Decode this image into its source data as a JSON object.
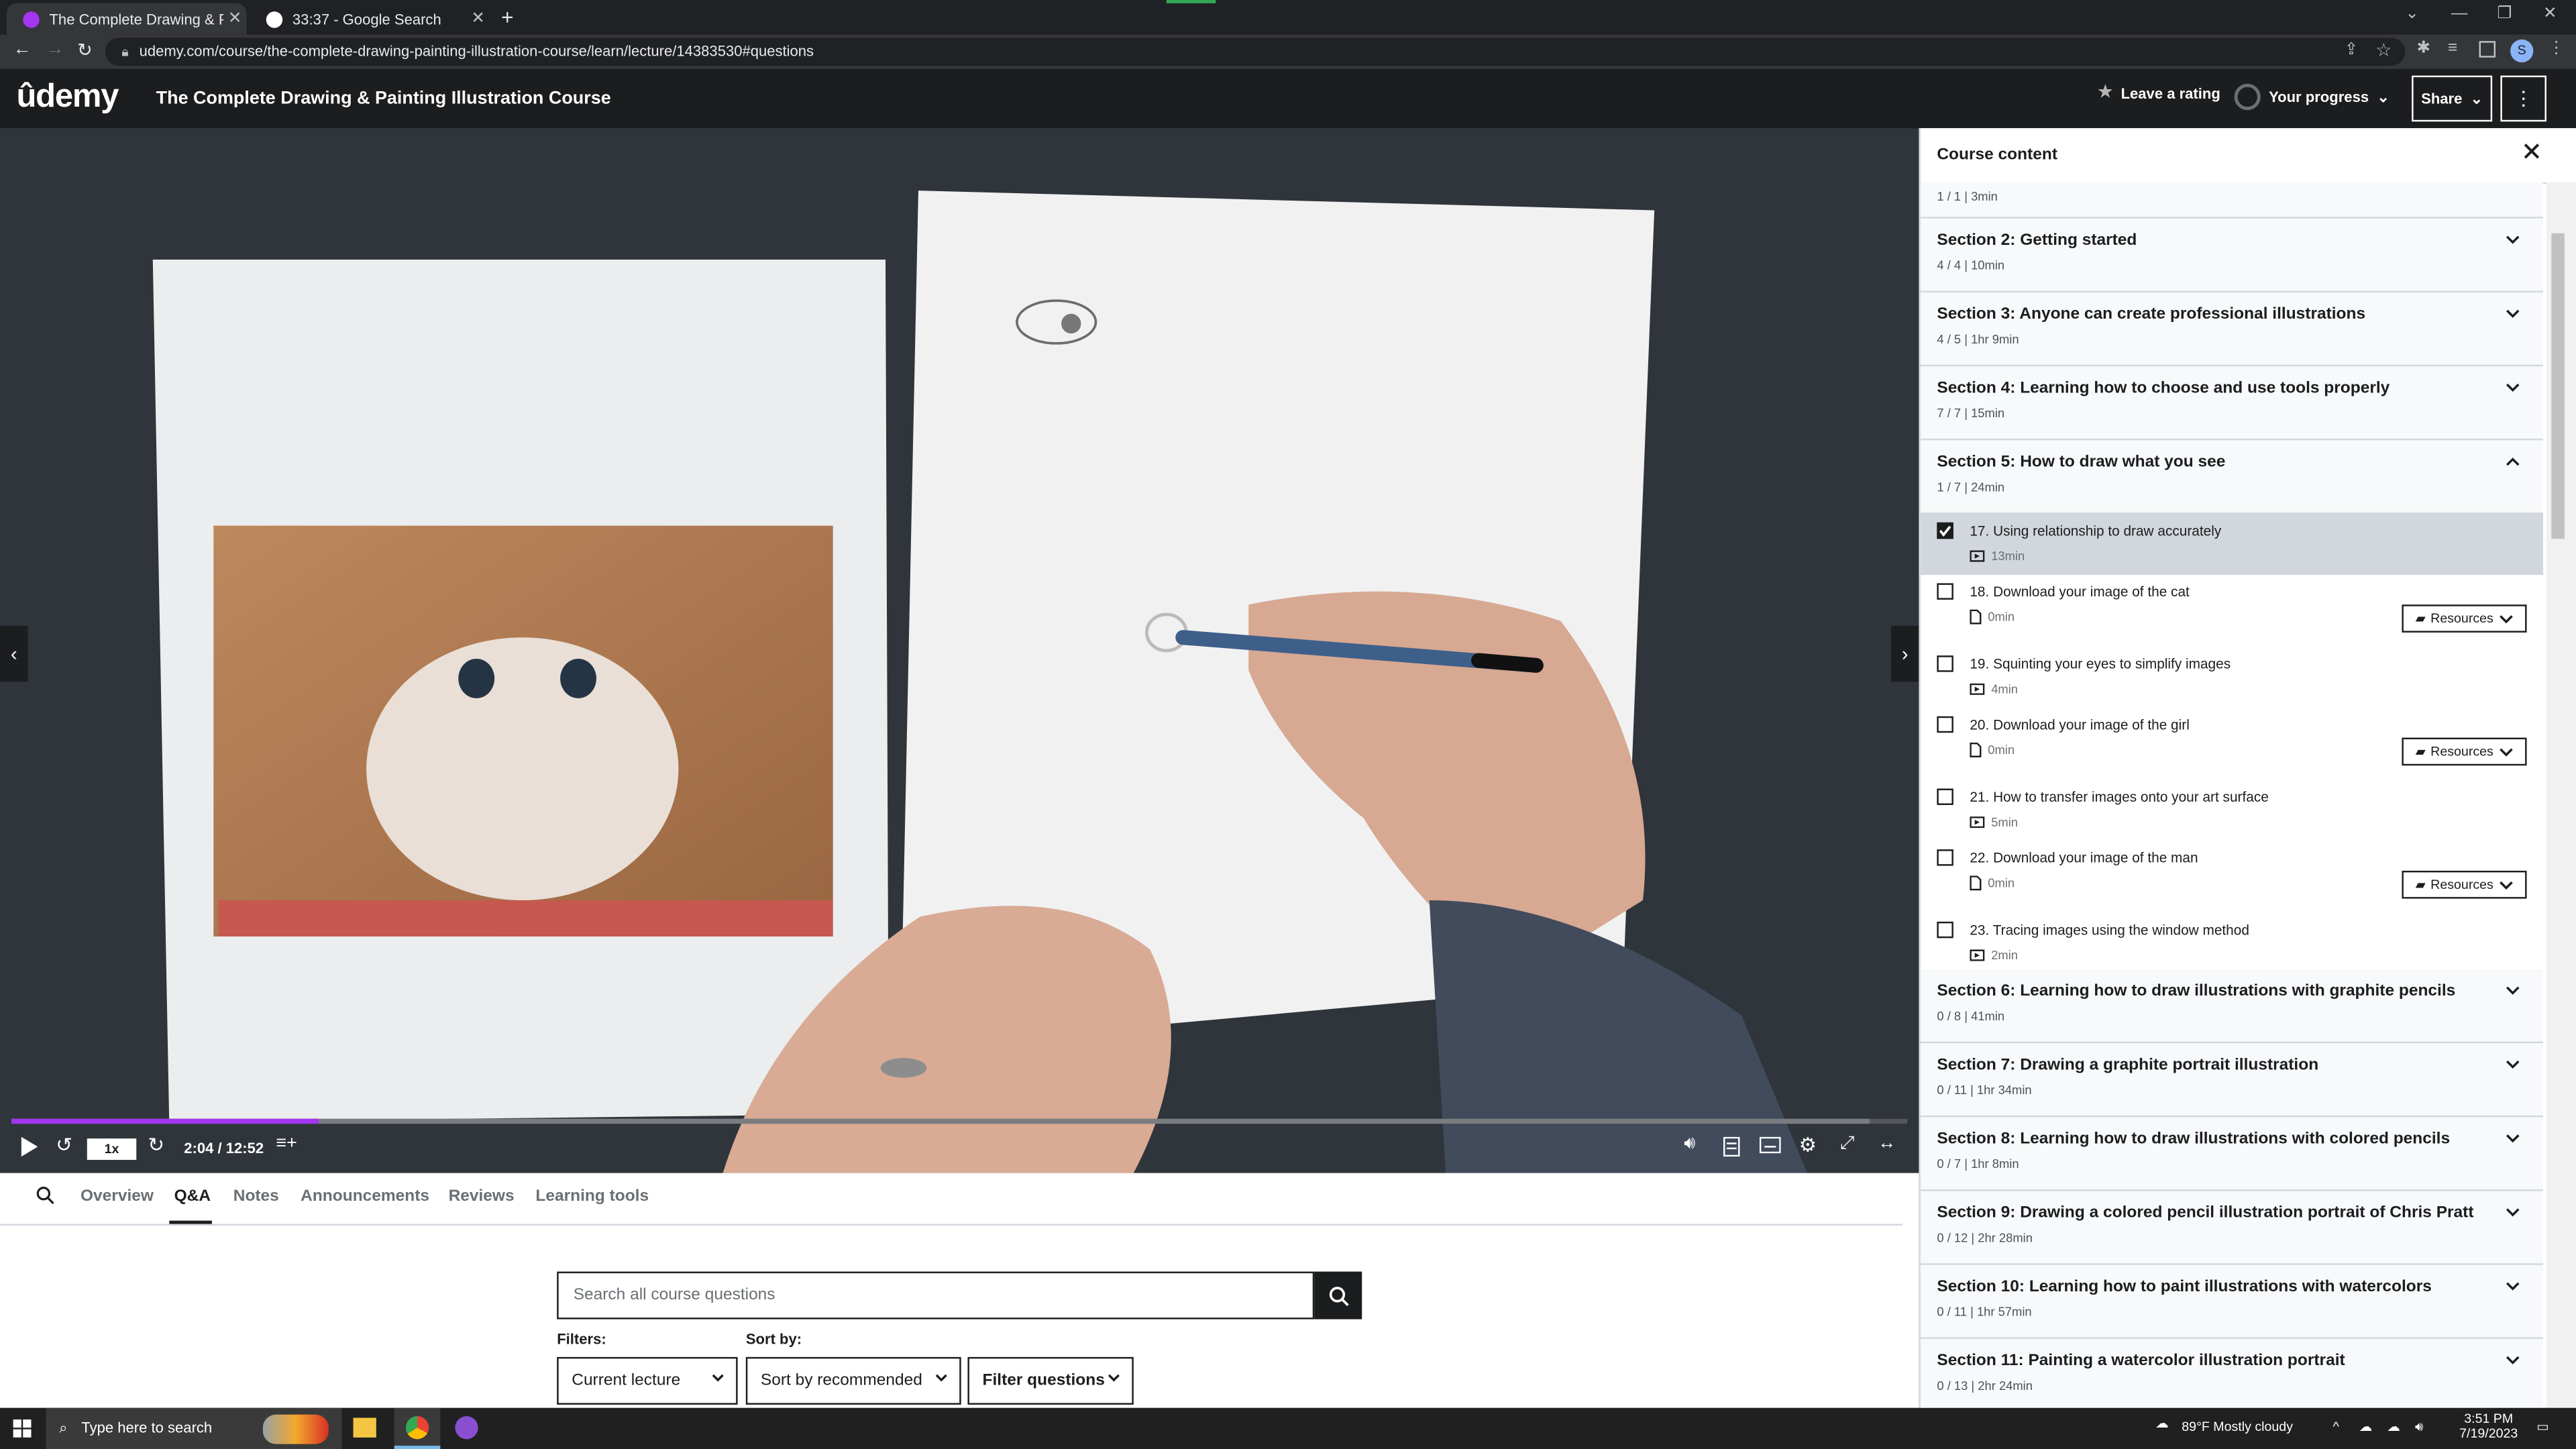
{
  "browser": {
    "tabs": [
      {
        "title": "The Complete Drawing & Paintin",
        "active": true
      },
      {
        "title": "33:37 - Google Search",
        "active": false
      }
    ],
    "url": "udemy.com/course/the-complete-drawing-painting-illustration-course/learn/lecture/14383530#questions"
  },
  "header": {
    "logo": "ûdemy",
    "course_title": "The Complete Drawing & Painting Illustration Course",
    "leave_rating": "Leave a rating",
    "your_progress": "Your progress",
    "share": "Share"
  },
  "player": {
    "speed": "1x",
    "time": "2:04 / 12:52",
    "progress_fraction": 0.162,
    "buffered_fraction": 0.98
  },
  "content_tabs": [
    "Overview",
    "Q&A",
    "Notes",
    "Announcements",
    "Reviews",
    "Learning tools"
  ],
  "active_tab": "Q&A",
  "qa": {
    "search_placeholder": "Search all course questions",
    "filters_label": "Filters:",
    "sort_label": "Sort by:",
    "filter_value": "Current lecture",
    "sort_value": "Sort by recommended",
    "filter_questions": "Filter questions"
  },
  "sidebar": {
    "title": "Course content",
    "top_meta": "1 / 1 | 3min",
    "sections_before": [
      {
        "title": "Section 2: Getting started",
        "meta": "4 / 4 | 10min"
      },
      {
        "title": "Section 3: Anyone can create professional illustrations",
        "meta": "4 / 5 | 1hr 9min"
      },
      {
        "title": "Section 4: Learning how to choose and use tools properly",
        "meta": "7 / 7 | 15min"
      }
    ],
    "open_section": {
      "title": "Section 5: How to draw what you see",
      "meta": "1 / 7 | 24min"
    },
    "lectures": [
      {
        "title": "17. Using relationship to draw accurately",
        "meta": "13min",
        "type": "video",
        "checked": true,
        "current": true,
        "resources": ""
      },
      {
        "title": "18. Download your image of the cat",
        "meta": "0min",
        "type": "file",
        "checked": false,
        "current": false,
        "resources": "Resources"
      },
      {
        "title": "19. Squinting your eyes to simplify images",
        "meta": "4min",
        "type": "video",
        "checked": false,
        "current": false,
        "resources": ""
      },
      {
        "title": "20. Download your image of the girl",
        "meta": "0min",
        "type": "file",
        "checked": false,
        "current": false,
        "resources": "Resources"
      },
      {
        "title": "21. How to transfer images onto your art surface",
        "meta": "5min",
        "type": "video",
        "checked": false,
        "current": false,
        "resources": ""
      },
      {
        "title": "22. Download your image of the man",
        "meta": "0min",
        "type": "file",
        "checked": false,
        "current": false,
        "resources": "Resources"
      },
      {
        "title": "23. Tracing images using the window method",
        "meta": "2min",
        "type": "video",
        "checked": false,
        "current": false,
        "resources": ""
      }
    ],
    "sections_after": [
      {
        "title": "Section 6: Learning how to draw illustrations with graphite pencils",
        "meta": "0 / 8 | 41min"
      },
      {
        "title": "Section 7: Drawing a graphite portrait illustration",
        "meta": "0 / 11 | 1hr 34min"
      },
      {
        "title": "Section 8: Learning how to draw illustrations with colored pencils",
        "meta": "0 / 7 | 1hr 8min"
      },
      {
        "title": "Section 9: Drawing a colored pencil illustration portrait of Chris Pratt",
        "meta": "0 / 12 | 2hr 28min"
      },
      {
        "title": "Section 10: Learning how to paint illustrations with watercolors",
        "meta": "0 / 11 | 1hr 57min"
      },
      {
        "title": "Section 11: Painting a watercolor illustration portrait",
        "meta": "0 / 13 | 2hr 24min"
      }
    ]
  },
  "taskbar": {
    "search_placeholder": "Type here to search",
    "weather": "89°F  Mostly cloudy",
    "time": "3:51 PM",
    "date": "7/19/2023"
  },
  "colors": {
    "accent": "#a435f0",
    "dark": "#1c1d1f",
    "panel": "#f7f9fa"
  }
}
